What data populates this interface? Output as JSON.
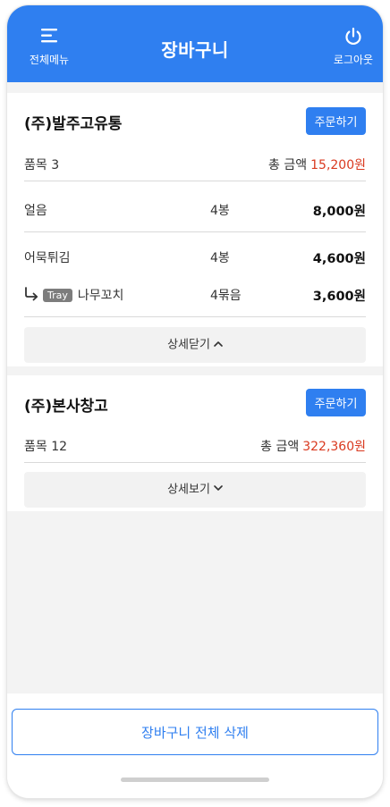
{
  "header": {
    "title": "장바구니",
    "menu_label": "전체메뉴",
    "logout_label": "로그아웃"
  },
  "cards": [
    {
      "name": "(주)발주고유통",
      "order_label": "주문하기",
      "items_label": "품목 3",
      "total_label": "총 금액",
      "total_amount": "15,200원",
      "rows": [
        {
          "name": "얼음",
          "qty": "4봉",
          "price": "8,000원"
        },
        {
          "name": "어묵튀김",
          "qty": "4봉",
          "price": "4,600원"
        },
        {
          "badge": "Tray",
          "name": "나무꼬치",
          "qty": "4묶음",
          "price": "3,600원",
          "sub_item": true
        }
      ],
      "toggle_label": "상세닫기",
      "toggle_icon": "chevron-up-icon"
    },
    {
      "name": "(주)본사창고",
      "order_label": "주문하기",
      "items_label": "품목 12",
      "total_label": "총 금액",
      "total_amount": "322,360원",
      "toggle_label": "상세보기",
      "toggle_icon": "chevron-down-icon"
    }
  ],
  "footer": {
    "delete_all_label": "장바구니 전체 삭제"
  },
  "colors": {
    "accent": "#2f7ff0",
    "price_red": "#d9391f",
    "background": "#f3f3f3"
  }
}
